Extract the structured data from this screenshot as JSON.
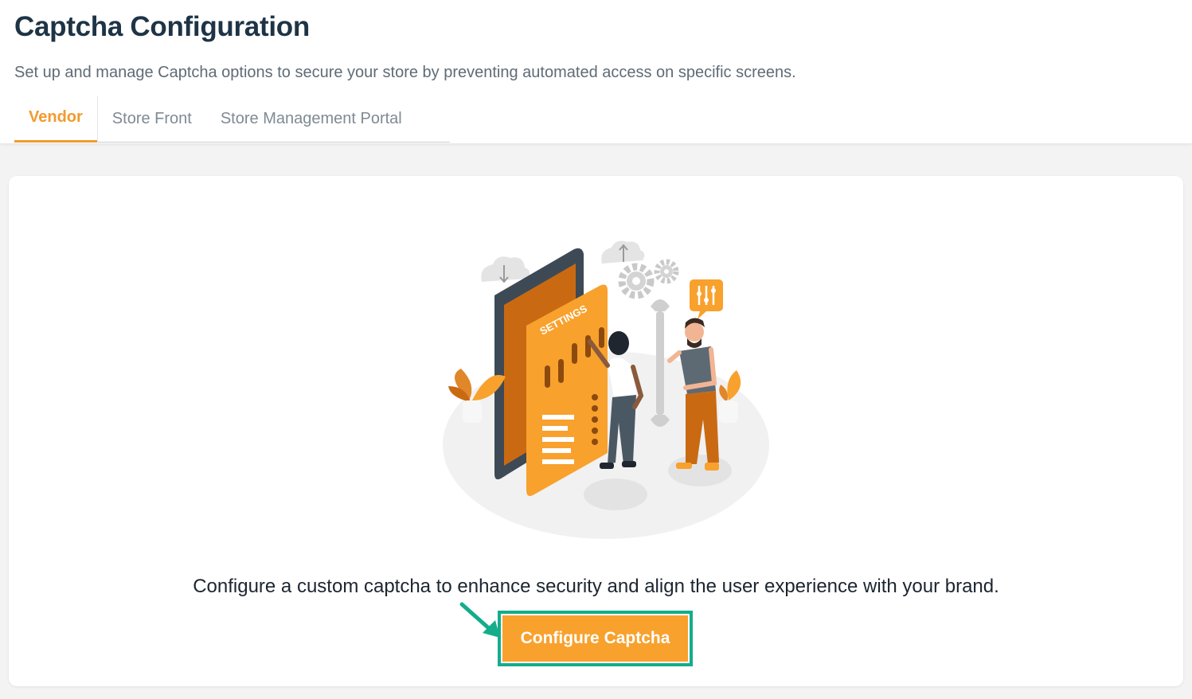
{
  "header": {
    "title": "Captcha Configuration",
    "subtitle": "Set up and manage Captcha options to secure your store by preventing automated access on specific screens."
  },
  "tabs": [
    {
      "label": "Vendor",
      "active": true
    },
    {
      "label": "Store Front",
      "active": false
    },
    {
      "label": "Store Management Portal",
      "active": false
    }
  ],
  "card": {
    "illustration_text": "SETTINGS",
    "description": "Configure a custom captcha to enhance security and align the user experience with your brand.",
    "button_label": "Configure Captcha"
  },
  "colors": {
    "accent": "#f8a12d",
    "active_tab": "#f29a2e",
    "highlight": "#14ad8c",
    "title": "#1e3446"
  },
  "icons": [
    "cloud-download-icon",
    "cloud-upload-icon",
    "gear-icon",
    "sliders-icon",
    "wrench-icon",
    "pointer-arrow-icon"
  ]
}
